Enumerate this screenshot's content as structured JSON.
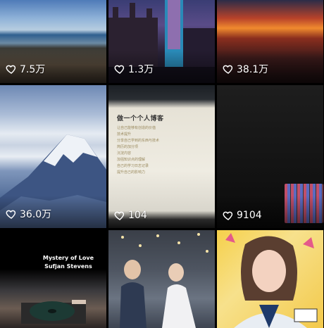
{
  "tiles": [
    {
      "likes": "7.5万"
    },
    {
      "likes": "1.3万"
    },
    {
      "likes": "38.1万"
    },
    {
      "likes": "36.0万"
    },
    {
      "likes": "104"
    },
    {
      "likes": "9104"
    },
    {
      "likes": ""
    },
    {
      "likes": ""
    },
    {
      "likes": ""
    }
  ],
  "doc": {
    "title": "做一个个人博客",
    "lines": [
      "让自己能够有创造的价值",
      "技术提升",
      "分享自己学到的东西与技术",
      "简历的加分项",
      "沉淀内容",
      "加强知识点的理解",
      "自己的学习日志记录",
      "提升自己的影响力"
    ]
  },
  "song": {
    "line1": "Mystery of Love",
    "line2": "Sufjan Stevens"
  },
  "icons": {
    "like": "heart-icon"
  },
  "colors": {
    "background": "#000000",
    "like_text": "#ffffff"
  }
}
